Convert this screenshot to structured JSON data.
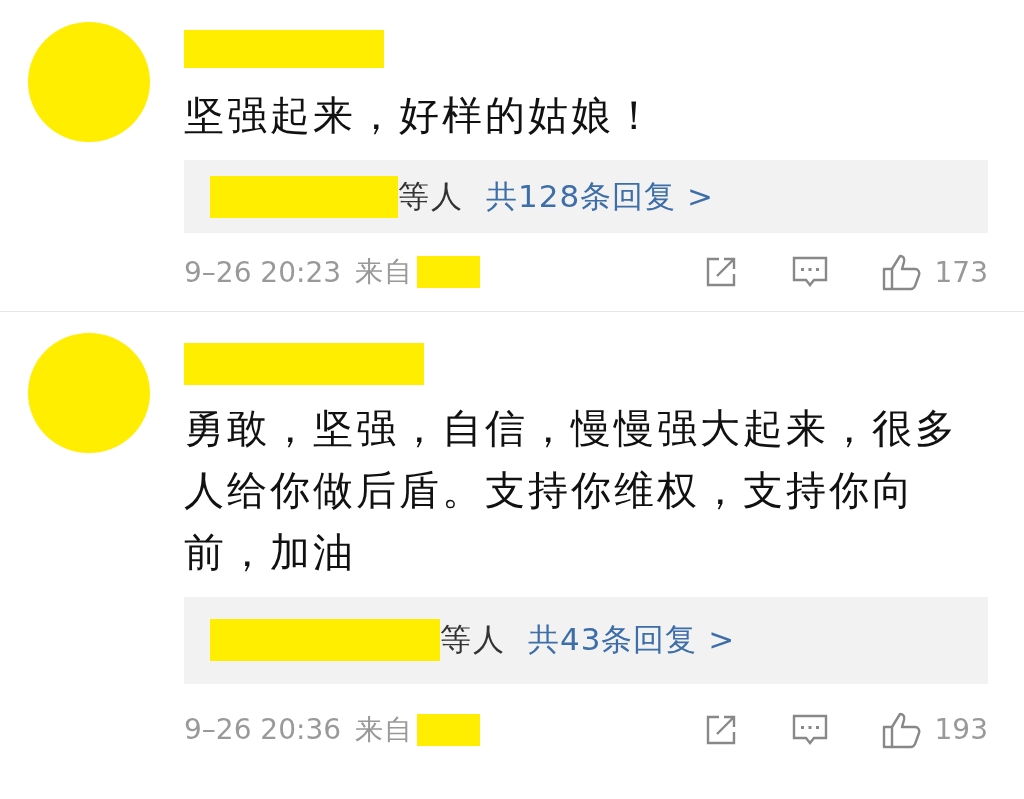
{
  "comments": [
    {
      "text": "坚强起来，好样的姑娘！",
      "reply_suffix": "等人",
      "reply_link": "共128条回复 >",
      "time": "9–26 20:23",
      "source_label": "来自",
      "likes": "173"
    },
    {
      "text": "勇敢，坚强，自信，慢慢强大起来，很多人给你做后盾。支持你维权，支持你向前，加油",
      "reply_suffix": "等人",
      "reply_link": "共43条回复 >",
      "time": "9–26 20:36",
      "source_label": "来自",
      "likes": "193"
    }
  ]
}
